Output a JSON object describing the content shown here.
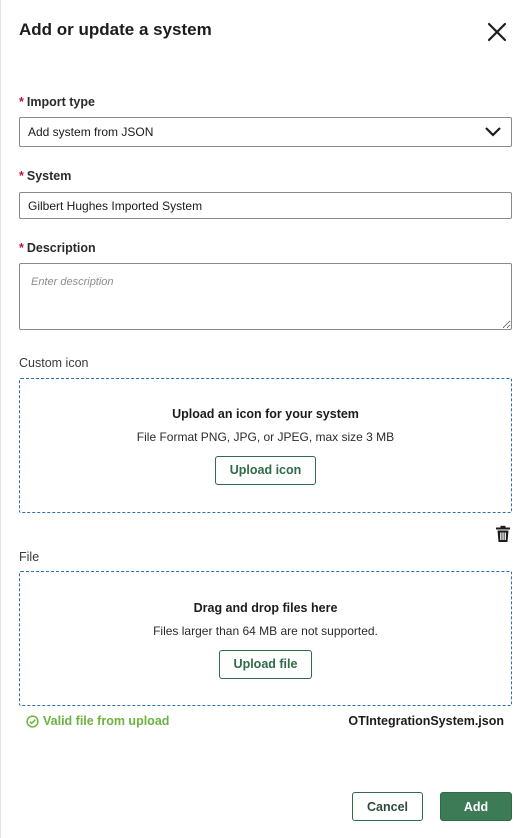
{
  "dialog": {
    "title": "Add or update a system"
  },
  "import_type": {
    "label": "Import type",
    "value": "Add system from JSON"
  },
  "system": {
    "label": "System",
    "value": "Gilbert Hughes Imported System"
  },
  "description": {
    "label": "Description",
    "placeholder": "Enter description"
  },
  "custom_icon": {
    "label": "Custom icon",
    "title": "Upload an icon for your system",
    "subtitle": "File Format PNG, JPG, or JPEG, max size 3 MB",
    "button": "Upload icon"
  },
  "file": {
    "label": "File",
    "title": "Drag and drop files here",
    "subtitle": "Files larger than 64 MB are not supported.",
    "button": "Upload file",
    "status": "Valid file from upload",
    "filename": "OTIntegrationSystem.json"
  },
  "footer": {
    "cancel": "Cancel",
    "add": "Add"
  },
  "colors": {
    "accent": "#2e6b47",
    "primary_button": "#3d7a56",
    "valid": "#6cb33f",
    "required": "#c8102e",
    "dropzone_border": "#2f6fb0"
  }
}
